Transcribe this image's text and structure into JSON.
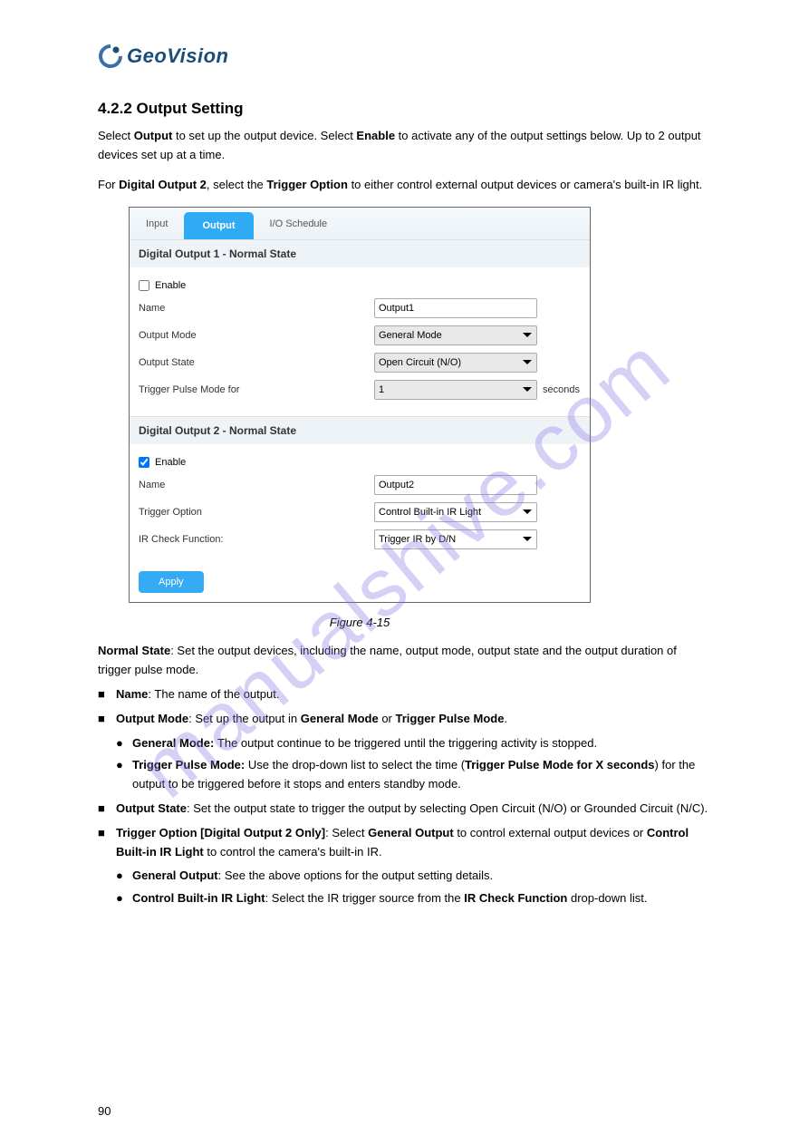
{
  "logo": {
    "text": "GeoVision"
  },
  "watermark": "manualshive.com",
  "heading": "4.2.2  Output Setting",
  "intro1": "Select ",
  "intro1b": "Output",
  "intro1c": " to set up the output device. Select ",
  "intro1d": "Enable",
  "intro1e": " to activate any of the output settings below. Up to 2 output devices set up at a time.",
  "intro2a": "For ",
  "intro2b": "Digital Output 2",
  "intro2c": ", select the ",
  "intro2d": "Trigger Option",
  "intro2e": " to either control external output devices or camera's built-in IR light.",
  "tabs": {
    "input": "Input",
    "output": "Output",
    "schedule": "I/O Schedule"
  },
  "section1": {
    "title": "Digital Output 1 - Normal State",
    "enable_label": "Enable",
    "name_label": "Name",
    "name_value": "Output1",
    "mode_label": "Output Mode",
    "mode_value": "General Mode",
    "state_label": "Output State",
    "state_value": "Open Circuit (N/O)",
    "pulse_label": "Trigger Pulse Mode for",
    "pulse_value": "1",
    "pulse_suffix": "seconds"
  },
  "section2": {
    "title": "Digital Output 2 - Normal State",
    "enable_label": "Enable",
    "name_label": "Name",
    "name_value": "Output2",
    "trigger_label": "Trigger Option",
    "trigger_value": "Control Built-in IR Light",
    "ir_label": "IR Check Function:",
    "ir_value": "Trigger IR by D/N"
  },
  "apply": "Apply",
  "figure": "Figure 4-15",
  "desc": {
    "d1a": "Normal State",
    "d1b": ": Set the output devices, including the name, output mode, output state and the output duration of trigger pulse mode.",
    "d2a": "Name",
    "d2b": ": The name of the output.",
    "d3a": "Output Mode",
    "d3b": ": Set up the output in ",
    "d3c": "General Mode",
    "d3d": " or ",
    "d3e": "Trigger Pulse Mode",
    "d3f": ".",
    "d4a": "General Mode: ",
    "d4b": "The output continue to be triggered until the triggering activity is stopped.",
    "d5a": "Trigger Pulse Mode: ",
    "d5b": "Use the drop-down list to select the time (",
    "d5c": "Trigger Pulse Mode for X seconds",
    "d5d": ") for the output to be triggered before it stops and enters standby mode.",
    "d6a": "Output State",
    "d6b": ": Set the output state to trigger the output by selecting Open Circuit (N/O) or Grounded Circuit (N/C).",
    "d7a": "Trigger Option [Digital Output 2 Only]",
    "d7b": ": Select ",
    "d7c": "General Output",
    "d7d": " to control external output devices or ",
    "d7e": "Control Built-in IR Light",
    "d7f": " to control the camera's built-in IR.",
    "d8a": "General Output",
    "d8b": ": See the above options for the output setting details.",
    "d9a": "Control Built-in IR Light",
    "d9b": ": Select the IR trigger source from the ",
    "d9c": "IR Check Function",
    "d9d": " drop-down list."
  },
  "page_number": "90"
}
